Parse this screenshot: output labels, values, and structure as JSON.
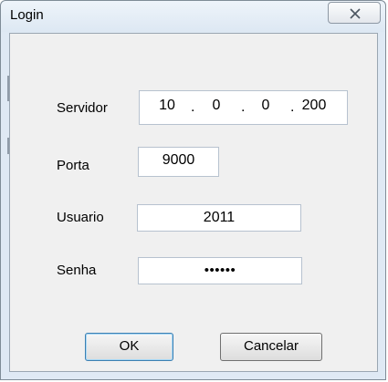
{
  "window": {
    "title": "Login",
    "close_icon": "close-icon",
    "colors": {
      "frame": "#dfe9f4",
      "client": "#f0f0f0",
      "border": "#9aa6b2"
    }
  },
  "form": {
    "servidor": {
      "label": "Servidor",
      "segments": [
        "10",
        "0",
        "0",
        "200"
      ]
    },
    "porta": {
      "label": "Porta",
      "value": "9000"
    },
    "usuario": {
      "label": "Usuario",
      "value": "2011"
    },
    "senha": {
      "label": "Senha",
      "value": "••••••"
    }
  },
  "buttons": {
    "ok": "OK",
    "cancelar": "Cancelar"
  }
}
